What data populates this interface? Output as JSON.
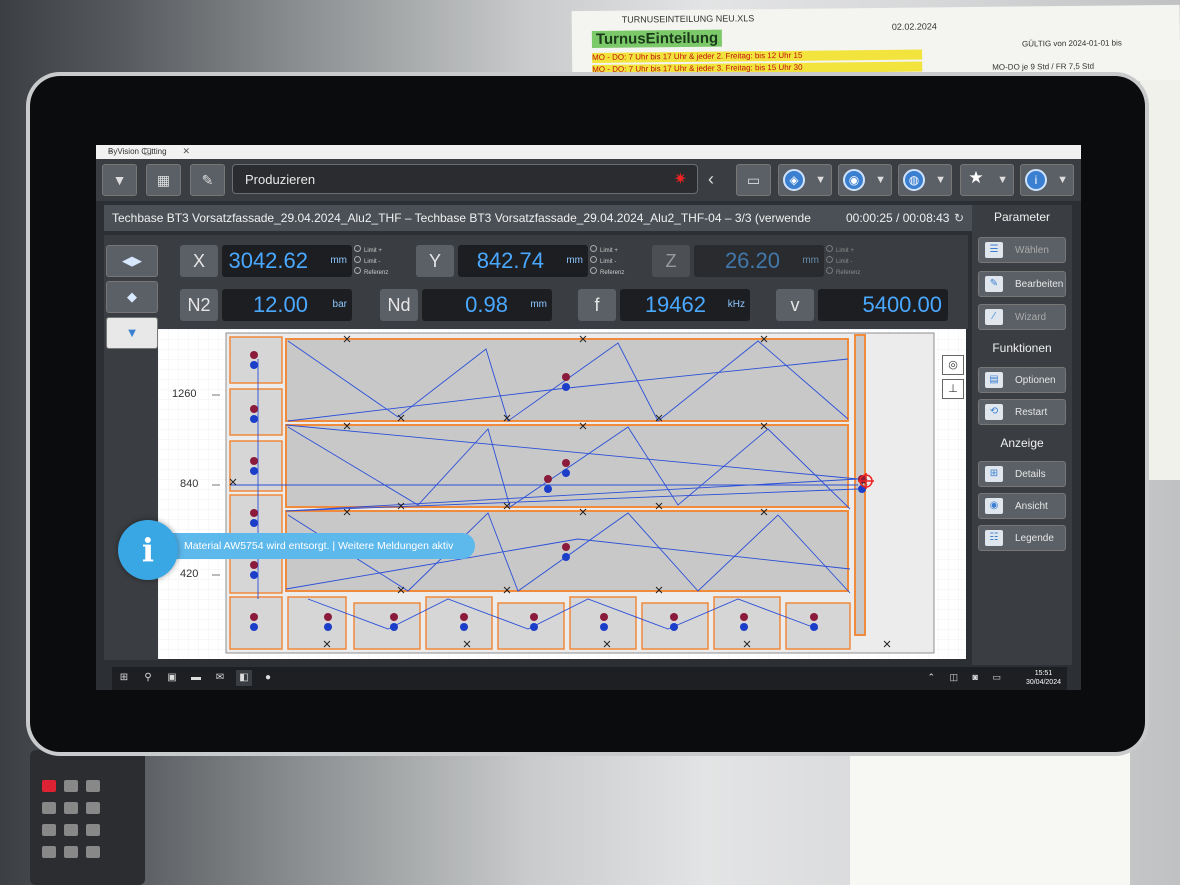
{
  "wall": {
    "sheet_title": "TURNUSEINTEILUNG NEU.XLS",
    "sheet_date": "02.02.2024",
    "sheet_heading": "TurnusEinteilung",
    "sheet_validity": "GÜLTIG von 2024-01-01 bis",
    "sheet_row1": "MO - DO:   7 Uhr bis 17 Uhr  &   jeder 2. Freitag: bis 12 Uhr 15",
    "sheet_row2": "MO - DO:   7 Uhr bis 17 Uhr  &   jeder 3. Freitag: bis 15 Uhr 30",
    "sheet_note": "MO-DO je 9 Std / FR 7,5 Std"
  },
  "window": {
    "title": "ByVision Cutting",
    "controls": "–  ▢  ✕"
  },
  "toolbar": {
    "mode_label": "Produzieren",
    "back_glyph": "‹"
  },
  "job": {
    "name": "Techbase BT3 Vorsatzfassade_29.04.2024_Alu2_THF – Techbase BT3 Vorsatzfassade_29.04.2024_Alu2_THF-04 – 3/3 (verwende",
    "time": "00:00:25 / 00:08:43",
    "refresh_glyph": "↻"
  },
  "readouts": {
    "x": {
      "label": "X",
      "value": "3042.62",
      "unit": "mm"
    },
    "y": {
      "label": "Y",
      "value": "842.74",
      "unit": "mm"
    },
    "z": {
      "label": "Z",
      "value": "26.20",
      "unit": "mm"
    },
    "n2": {
      "label": "N2",
      "value": "12.00",
      "unit": "bar"
    },
    "nd": {
      "label": "Nd",
      "value": "0.98",
      "unit": "mm"
    },
    "f": {
      "label": "f",
      "value": "19462",
      "unit": "kHz"
    },
    "v": {
      "label": "v",
      "value": "5400.00",
      "unit": ""
    },
    "limit_plus": "Limit +",
    "limit_minus": "Limit -",
    "reference": "Referenz"
  },
  "axis": {
    "y_ticks": [
      "1260",
      "840",
      "420"
    ]
  },
  "notification": {
    "icon": "i",
    "message": "Material AW5754 wird entsorgt.  |  Weitere Meldungen aktiv"
  },
  "right_panel": {
    "parameter_heading": "Parameter",
    "waehlen": "Wählen",
    "bearbeiten": "Bearbeiten",
    "wizard": "Wizard",
    "funktionen_heading": "Funktionen",
    "optionen": "Optionen",
    "restart": "Restart",
    "anzeige_heading": "Anzeige",
    "details": "Details",
    "ansicht": "Ansicht",
    "legende": "Legende"
  },
  "taskbar": {
    "time": "15:51",
    "date": "30/04/2024"
  },
  "colors": {
    "accent_blue": "#4aa8ff",
    "part_outline": "#f08a3c",
    "path_blue": "#2b4fd8"
  }
}
